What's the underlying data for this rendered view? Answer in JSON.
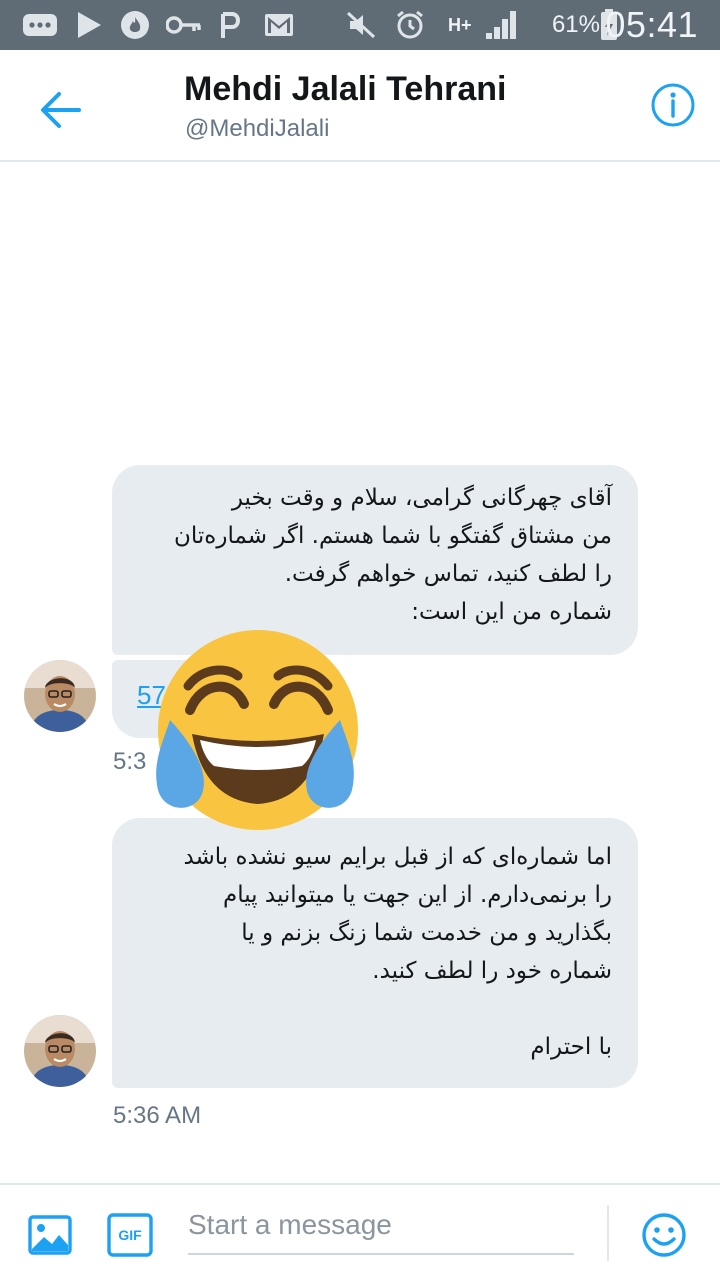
{
  "status_bar": {
    "battery_percent": "61%",
    "network": "H+",
    "time": "05:41",
    "icons": [
      "more-icon",
      "play-icon",
      "fire-icon",
      "key-icon",
      "p-icon",
      "gmail-icon",
      "mute-icon",
      "alarm-icon",
      "signal-icon",
      "battery-charging-icon"
    ]
  },
  "header": {
    "name": "Mehdi Jalali Tehrani",
    "handle": "@MehdiJalali",
    "back_icon": "back-arrow-icon",
    "info_icon": "info-icon"
  },
  "messages": [
    {
      "text": "آقای چهرگانی گرامی، سلام و وقت بخیر\nمن مشتاق گفتگو با شما هستم.  اگر شماره‌تان\nرا لطف کنید، تماس خواهم گرفت.\nشماره من این است:"
    },
    {
      "link_text": "57"
    },
    {
      "timestamp": "5:3"
    },
    {
      "text": "اما شماره‌ای که از قبل برایم سیو نشده باشد\nرا برنمی‌دارم. از این جهت یا میتوانید پیام\nبگذارید و من خدمت شما زنگ بزنم و یا\nشماره خود را لطف کنید.\n\nبا احترام",
      "timestamp": "5:36 AM"
    }
  ],
  "sticker": "tears-of-joy-emoji",
  "composer": {
    "placeholder": "Start a message",
    "photo_icon": "image-icon",
    "gif_label": "GIF",
    "emoji_icon": "smiley-icon"
  },
  "colors": {
    "accent": "#1da1f2",
    "status_bar": "#5f6b75",
    "bubble": "#e6ecf0"
  }
}
